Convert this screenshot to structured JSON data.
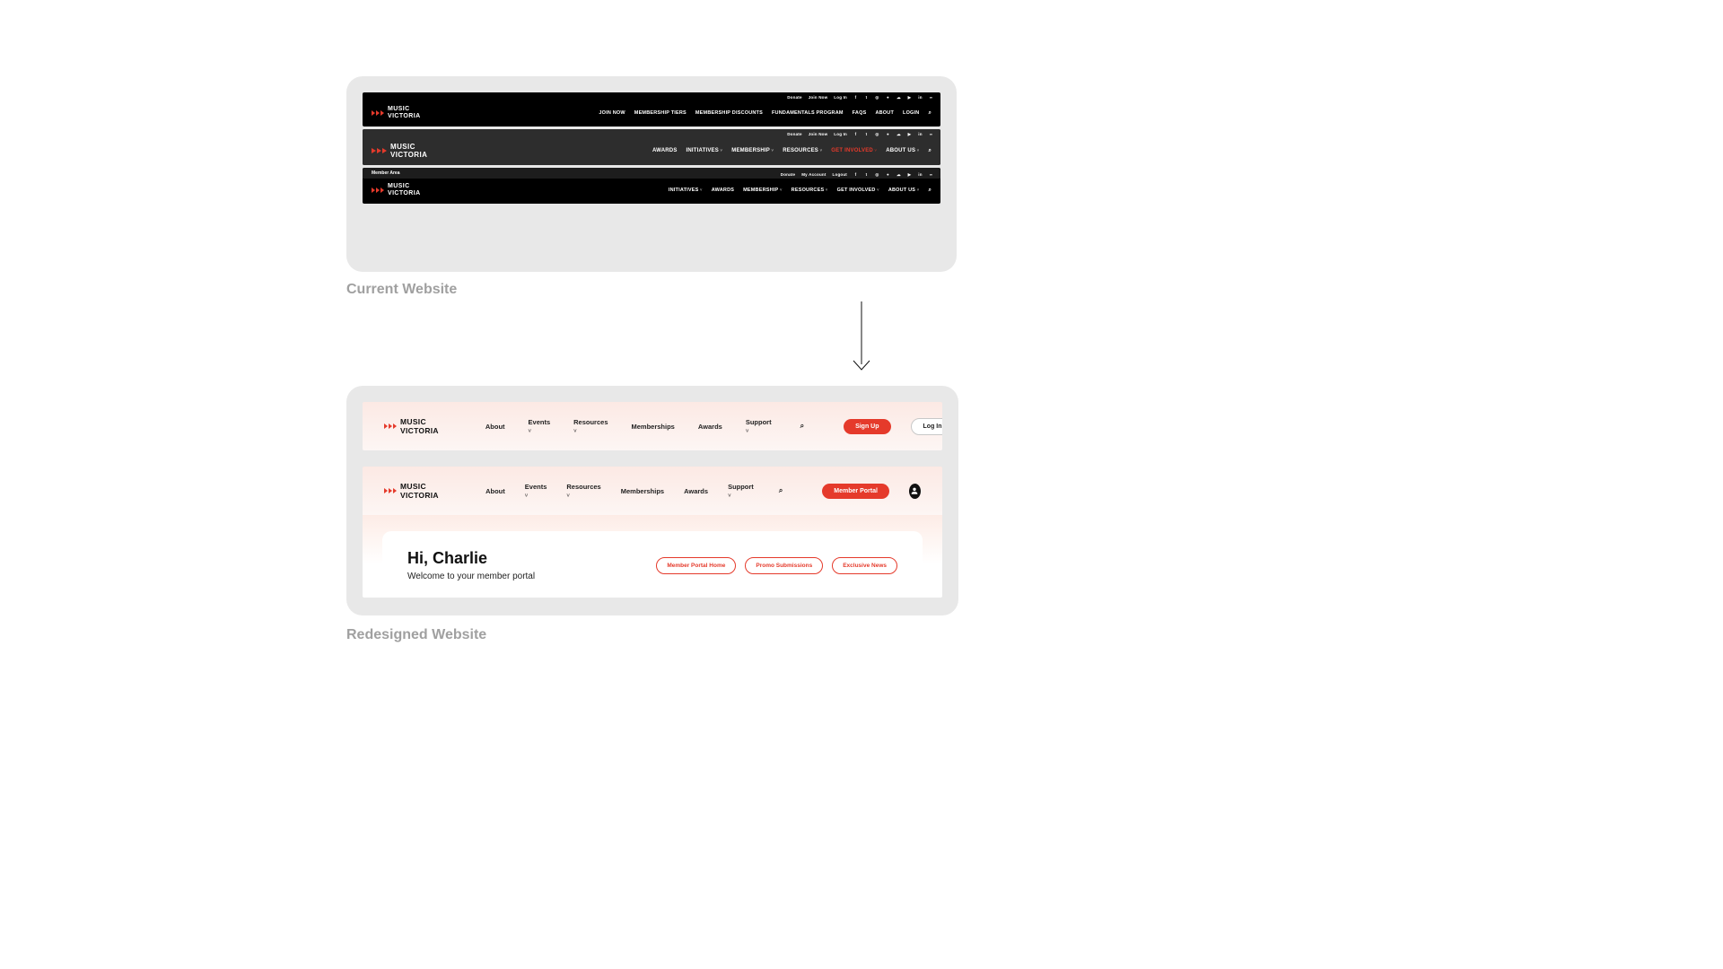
{
  "captions": {
    "current": "Current Website",
    "redesigned": "Redesigned Website"
  },
  "current": {
    "brand": {
      "line1": "MUSIC",
      "line2": "VICTORIA"
    },
    "topbar_links": {
      "donate": "Donate",
      "join_now": "Join Now",
      "log_in": "Log In",
      "my_account": "My Account",
      "logout": "Logout"
    },
    "social_names": [
      "facebook",
      "twitter",
      "instagram",
      "spotify",
      "soundcloud",
      "youtube",
      "linkedin",
      "share"
    ],
    "nav": {
      "v1_items": [
        "JOIN NOW",
        "MEMBERSHIP TIERS",
        "MEMBERSHIP DISCOUNTS",
        "FUNDAMENTALS PROGRAM",
        "FAQS",
        "ABOUT",
        "LOGIN"
      ],
      "v2_items": [
        "AWARDS",
        "INITIATIVES",
        "MEMBERSHIP",
        "RESOURCES",
        "GET INVOLVED",
        "ABOUT US"
      ],
      "v2_hot_index": 4,
      "v3_items": [
        "INITIATIVES",
        "AWARDS",
        "MEMBERSHIP",
        "RESOURCES",
        "GET INVOLVED",
        "ABOUT US"
      ],
      "member_area": "Member Area"
    }
  },
  "redesign": {
    "brand": "MUSIC VICTORIA",
    "nav_items": [
      "About",
      "Events",
      "Resources",
      "Memberships",
      "Awards",
      "Support"
    ],
    "nav_dropdown_idx": [
      1,
      2,
      5
    ],
    "buttons": {
      "sign_up": "Sign Up",
      "log_in": "Log In",
      "member_portal": "Member Portal"
    },
    "greeting": {
      "title": "Hi, Charlie",
      "subtitle": "Welcome to your member portal"
    },
    "portal_pills": [
      "Member Portal Home",
      "Promo Submissions",
      "Exclusive News"
    ]
  }
}
